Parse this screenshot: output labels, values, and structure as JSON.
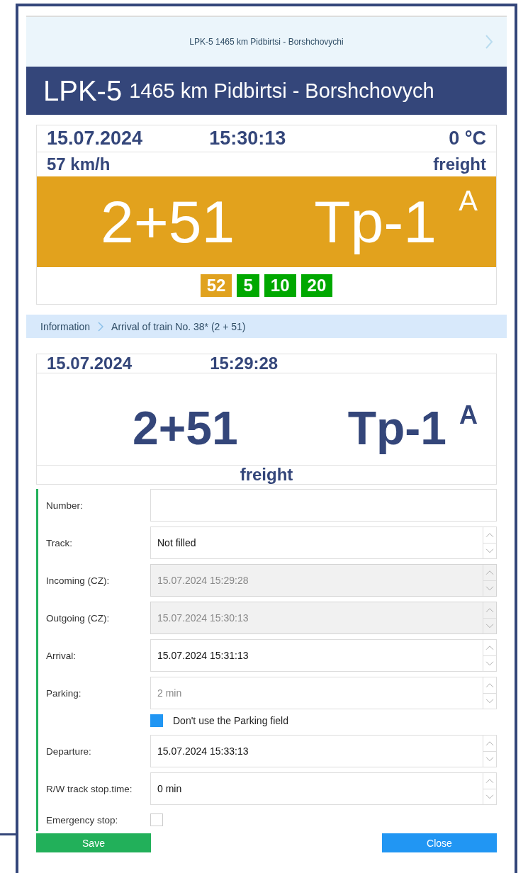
{
  "top_bar": {
    "title": "LPK-5 1465 km Pidbirtsi - Borshchovychi"
  },
  "header": {
    "code": "LPK-5",
    "location": "1465 km Pidbirtsi - Borshchovych"
  },
  "status_card": {
    "date": "15.07.2024",
    "time": "15:30:13",
    "temperature": "0 °C",
    "speed": "57 km/h",
    "train_type": "freight",
    "train": "2+51",
    "track": "Tp-1",
    "track_mark": "A",
    "badges": [
      {
        "text": "52",
        "color": "#e0a21f"
      },
      {
        "text": "5",
        "color": "#00a800"
      },
      {
        "text": "10",
        "color": "#00a800"
      },
      {
        "text": "20",
        "color": "#00a800"
      }
    ]
  },
  "breadcrumb": [
    "Information",
    "Arrival of train No. 38* (2 + 51)"
  ],
  "event_card": {
    "date": "15.07.2024",
    "time": "15:29:28",
    "train": "2+51",
    "track": "Tp-1",
    "track_mark": "A",
    "train_type": "freight"
  },
  "form": [
    {
      "kind": "text",
      "label": "Number:",
      "disabled": false
    },
    {
      "kind": "spinner",
      "label": "Track:",
      "value": "Not filled",
      "disabled": false
    },
    {
      "kind": "spinner",
      "label": "Incoming (CZ):",
      "value": "15.07.2024 15:29:28",
      "disabled": true
    },
    {
      "kind": "spinner",
      "label": "Outgoing (CZ):",
      "value": "15.07.2024 15:30:13",
      "disabled": true
    },
    {
      "kind": "spinner",
      "label": "Arrival:",
      "value": "15.07.2024 15:31:13",
      "disabled": false
    },
    {
      "kind": "spinner",
      "label": "Parking:",
      "placeholder": "2 min",
      "disabled": false
    },
    {
      "kind": "option",
      "label": "Don't use the Parking field",
      "checked": true
    },
    {
      "kind": "spinner",
      "label": "Departure:",
      "value": "15.07.2024 15:33:13",
      "disabled": false
    },
    {
      "kind": "spinner",
      "label": "R/W track stop.time:",
      "value": "0 min",
      "disabled": false
    },
    {
      "kind": "check",
      "label": "Emergency stop:",
      "checked": false
    }
  ],
  "buttons": {
    "save": "Save",
    "close": "Close"
  }
}
